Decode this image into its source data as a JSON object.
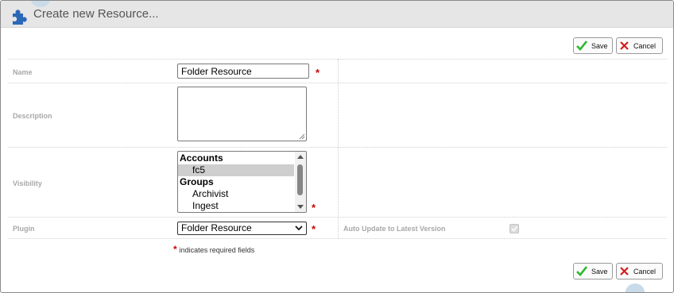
{
  "window": {
    "title": "Create new Resource...",
    "title_icon": "puzzle-piece-icon"
  },
  "toolbar_top": {
    "save_label": "Save",
    "cancel_label": "Cancel"
  },
  "toolbar_bottom": {
    "save_label": "Save",
    "cancel_label": "Cancel"
  },
  "form": {
    "name": {
      "label": "Name",
      "value": "Folder Resource",
      "required_marker": "*"
    },
    "description": {
      "label": "Description",
      "value": ""
    },
    "visibility": {
      "label": "Visibility",
      "required_marker": "*",
      "options": [
        {
          "text": "Accounts",
          "kind": "group"
        },
        {
          "text": "fc5",
          "kind": "option",
          "selected": true
        },
        {
          "text": "Groups",
          "kind": "group"
        },
        {
          "text": "Archivist",
          "kind": "option"
        },
        {
          "text": "Ingest",
          "kind": "option"
        }
      ]
    },
    "plugin": {
      "label": "Plugin",
      "selected": "Folder Resource",
      "required_marker": "*"
    },
    "auto_update": {
      "label": "Auto Update to Latest Version",
      "checked": true,
      "disabled": true
    }
  },
  "footnote": {
    "marker": "*",
    "text": "indicates required fields"
  },
  "colors": {
    "required": "#d00000",
    "save_check": "#2eb82e",
    "cancel_x": "#d81b1b",
    "label": "#a8a8a8",
    "titlebar": "#e6e6e6"
  }
}
